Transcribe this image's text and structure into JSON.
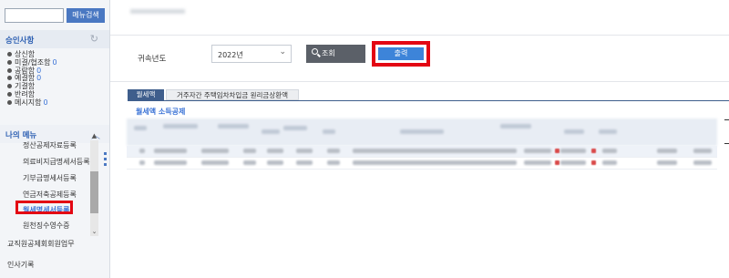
{
  "sidebar": {
    "menu_search_placeholder": "",
    "menu_search_button": "메뉴검색",
    "approval_section": {
      "title": "승인사항",
      "items": [
        {
          "label": "상신함",
          "count": ""
        },
        {
          "label": "미결/협조함",
          "count": "0"
        },
        {
          "label": "공람함",
          "count": "0"
        },
        {
          "label": "예결함",
          "count": "0"
        },
        {
          "label": "기결함",
          "count": ""
        },
        {
          "label": "반려함",
          "count": ""
        },
        {
          "label": "메시지함",
          "count": "0"
        }
      ]
    },
    "my_menu": {
      "title": "나의 메뉴",
      "items": [
        {
          "label": "정산공제자료등록",
          "active": false
        },
        {
          "label": "의료비지급명세서등록",
          "active": false
        },
        {
          "label": "기부금명세서등록",
          "active": false
        },
        {
          "label": "연금저축공제등록",
          "active": false
        },
        {
          "label": "월세명세서등록",
          "active": true
        },
        {
          "label": "원천징수영수증",
          "active": false
        }
      ]
    },
    "bottom_items": [
      "교직원공제회회원업무",
      "인사기록"
    ]
  },
  "main": {
    "filter": {
      "year_label": "귀속년도",
      "year_value": "2022년",
      "search_button": "조회",
      "print_button": "출력"
    },
    "tabs": [
      {
        "label": "월세액",
        "active": true
      },
      {
        "label": "거주자간 주택임차차입금 원리금상환액",
        "active": false
      }
    ],
    "section_title": "월세액 소득공제"
  },
  "colors": {
    "accent": "#3d84d9",
    "highlight": "#e30613",
    "tab_active": "#3f5e8c"
  }
}
